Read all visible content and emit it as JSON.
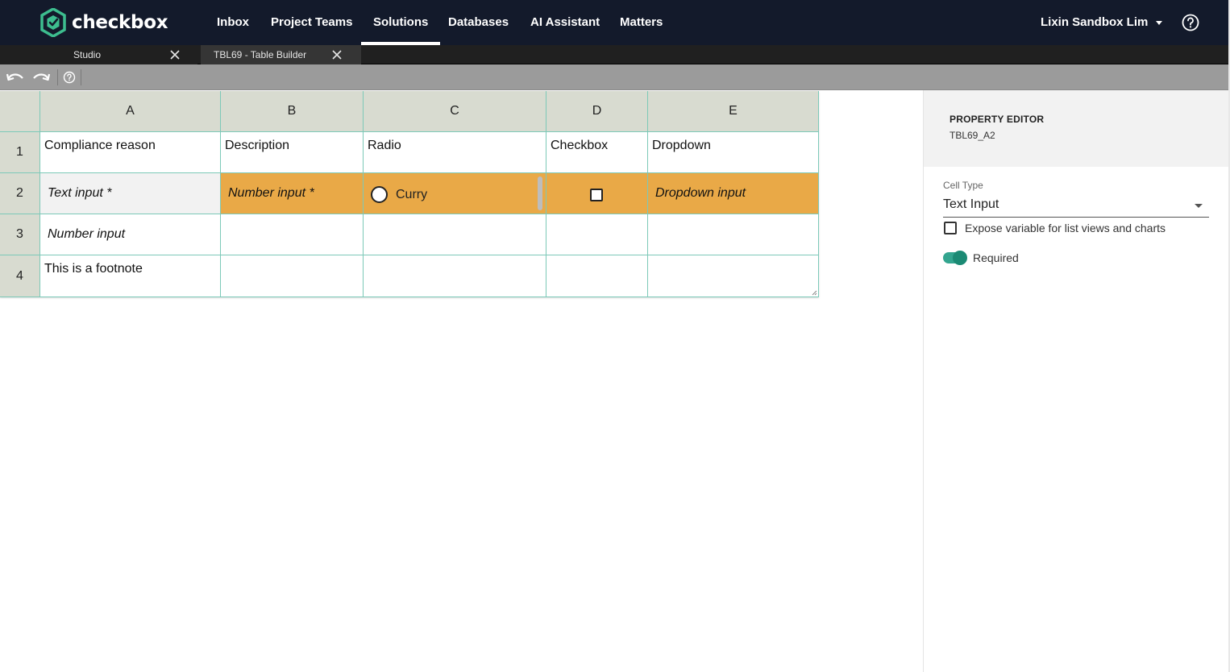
{
  "app": {
    "logo_text": "checkbox",
    "brand_color": "#3dbd8f"
  },
  "nav": {
    "items": [
      {
        "label": "Inbox"
      },
      {
        "label": "Project Teams"
      },
      {
        "label": "Solutions",
        "active": true
      },
      {
        "label": "Databases"
      },
      {
        "label": "AI Assistant"
      },
      {
        "label": "Matters"
      }
    ],
    "user": "Lixin Sandbox Lim"
  },
  "tabs": [
    {
      "label": "Studio"
    },
    {
      "label": "TBL69 - Table Builder",
      "active": true
    }
  ],
  "toolbar": {
    "icons": [
      "undo-icon",
      "redo-icon",
      "help-icon"
    ]
  },
  "grid": {
    "columns": [
      "A",
      "B",
      "C",
      "D",
      "E"
    ],
    "rows": [
      "1",
      "2",
      "3",
      "4"
    ],
    "cells": {
      "r1": [
        "Compliance reason",
        "Description",
        "Radio",
        "Checkbox",
        "Dropdown"
      ],
      "r2": {
        "a": "Text input *",
        "b": "Number input *",
        "c_radio": "Curry",
        "e": "Dropdown input"
      },
      "r3": {
        "a": "Number input"
      },
      "r4": {
        "a": "This is a footnote"
      }
    },
    "highlight_color": "#e9a947",
    "border_color": "#7cc9b8"
  },
  "property_editor": {
    "title": "PROPERTY EDITOR",
    "cell_ref": "TBL69_A2",
    "cell_type_label": "Cell Type",
    "cell_type_value": "Text Input",
    "expose_label": "Expose variable for list views and charts",
    "expose_checked": false,
    "required_label": "Required",
    "required_on": true
  }
}
